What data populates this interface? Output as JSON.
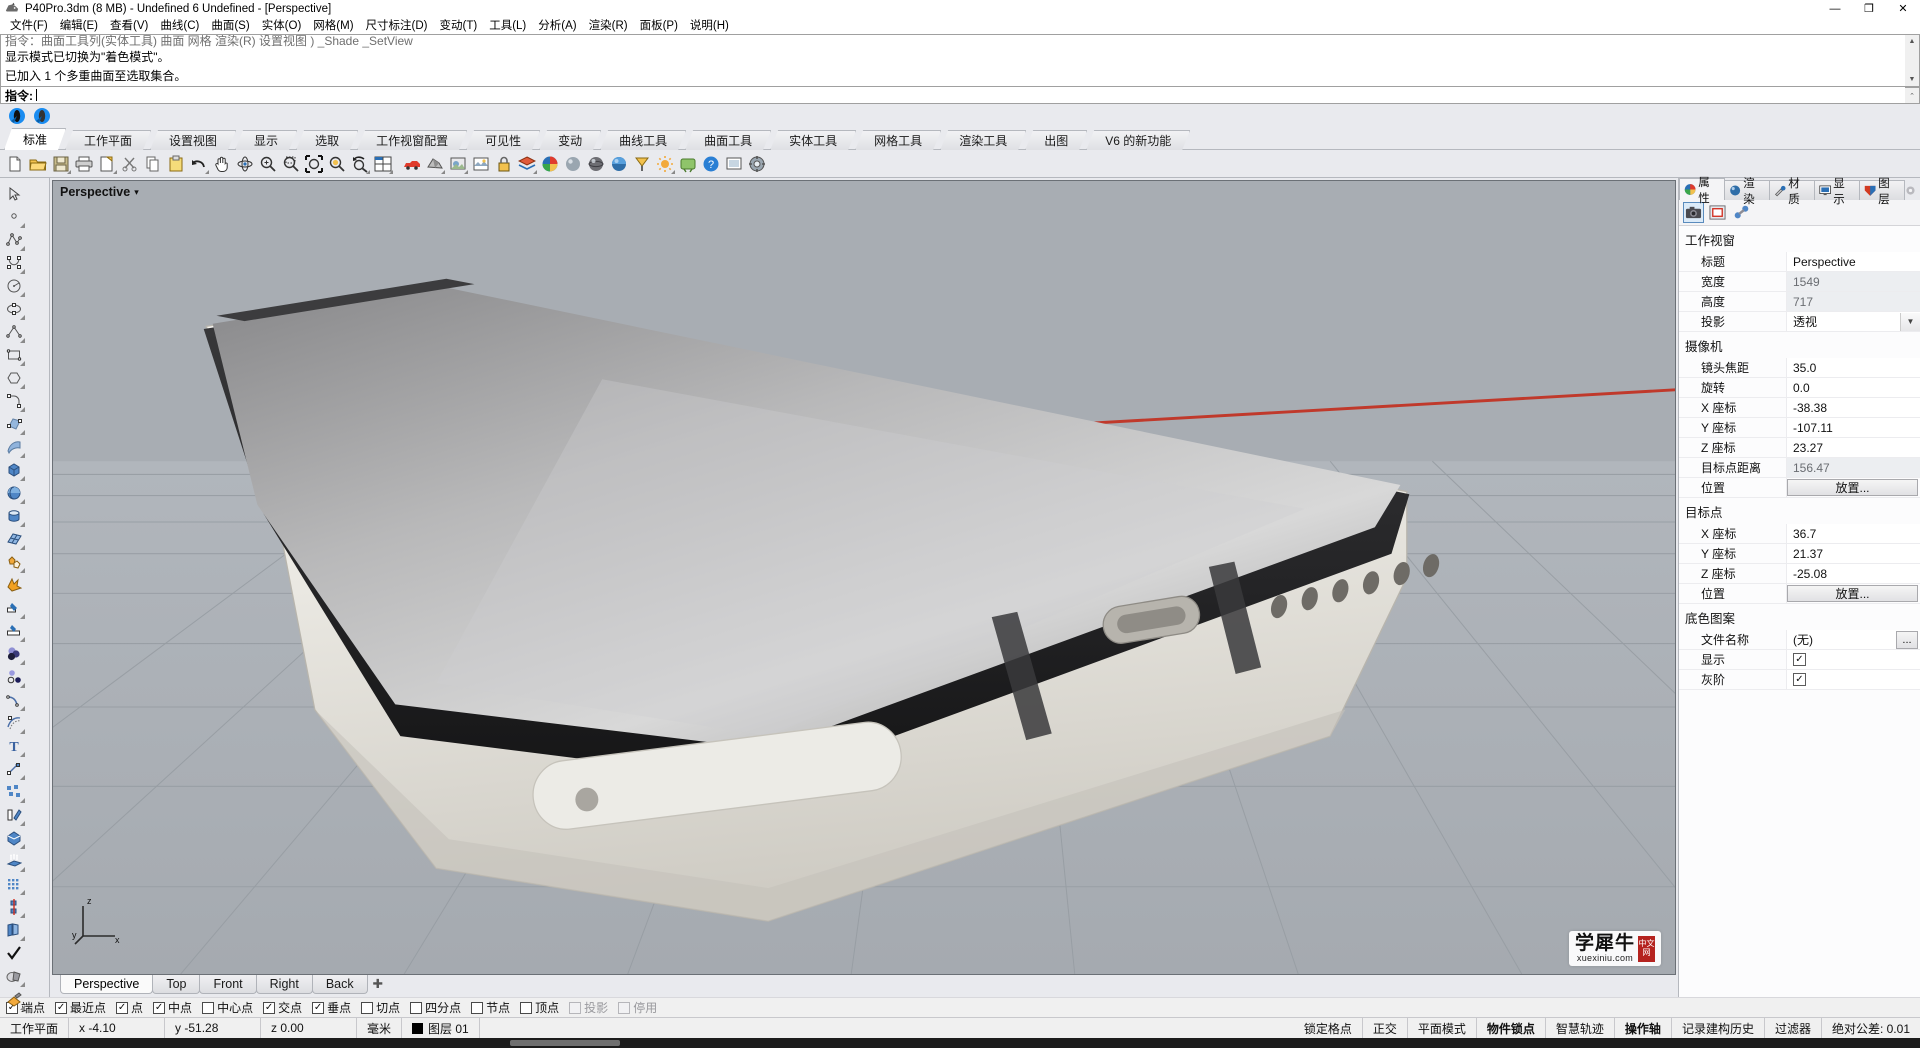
{
  "window": {
    "title": "P40Pro.3dm (8 MB) - Undefined 6 Undefined - [Perspective]",
    "minimize": "—",
    "maximize": "❐",
    "close": "✕"
  },
  "menu": {
    "items": [
      "文件(F)",
      "编辑(E)",
      "查看(V)",
      "曲线(C)",
      "曲面(S)",
      "实体(O)",
      "网格(M)",
      "尺寸标注(D)",
      "变动(T)",
      "工具(L)",
      "分析(A)",
      "渲染(R)",
      "面板(P)",
      "说明(H)"
    ]
  },
  "command_history": {
    "clipped_line": "指令：曲面工具列(实体工具)  曲面 网格  渲染(R)  设置视图 ) _Shade  _SetView",
    "lines": [
      "显示模式已切换为\"着色模式\"。",
      "已加入 1 个多重曲面至选取集合。"
    ],
    "prompt_label": "指令:",
    "prompt_value": ""
  },
  "ribbon": {
    "tabs": [
      {
        "label": "标准",
        "active": true
      },
      {
        "label": "工作平面",
        "active": false
      },
      {
        "label": "设置视图",
        "active": false
      },
      {
        "label": "显示",
        "active": false
      },
      {
        "label": "选取",
        "active": false
      },
      {
        "label": "工作视窗配置",
        "active": false
      },
      {
        "label": "可见性",
        "active": false
      },
      {
        "label": "变动",
        "active": false
      },
      {
        "label": "曲线工具",
        "active": false
      },
      {
        "label": "曲面工具",
        "active": false
      },
      {
        "label": "实体工具",
        "active": false
      },
      {
        "label": "网格工具",
        "active": false
      },
      {
        "label": "渲染工具",
        "active": false
      },
      {
        "label": "出图",
        "active": false
      },
      {
        "label": "V6 的新功能",
        "active": false
      }
    ]
  },
  "main_toolbar": {
    "buttons": [
      {
        "name": "new-file-icon",
        "glyph": "new"
      },
      {
        "name": "open-file-icon",
        "glyph": "open"
      },
      {
        "name": "save-file-icon",
        "glyph": "save"
      },
      {
        "name": "print-icon",
        "glyph": "print"
      },
      {
        "name": "cut-to-clipboard-icon",
        "glyph": "export"
      },
      {
        "name": "scissors-cut-icon",
        "glyph": "scissors"
      },
      {
        "name": "copy-icon",
        "glyph": "copy"
      },
      {
        "name": "paste-icon",
        "glyph": "paste"
      },
      {
        "name": "undo-icon",
        "glyph": "undo"
      },
      {
        "name": "pan-hand-icon",
        "glyph": "hand"
      },
      {
        "name": "rotate-view-icon",
        "glyph": "rotate"
      },
      {
        "name": "zoom-in-out-icon",
        "glyph": "zoomplus"
      },
      {
        "name": "zoom-window-icon",
        "glyph": "zoomwin"
      },
      {
        "name": "zoom-extents-icon",
        "glyph": "zoomext"
      },
      {
        "name": "zoom-selected-icon",
        "glyph": "zoomsel"
      },
      {
        "name": "zoom-previous-icon",
        "glyph": "zoomprev"
      },
      {
        "name": "four-viewport-icon",
        "glyph": "fourview"
      },
      {
        "name": "render-car-icon",
        "glyph": "car"
      },
      {
        "name": "shade-icon",
        "glyph": "shade"
      },
      {
        "name": "render-preview-icon",
        "glyph": "renderprev"
      },
      {
        "name": "named-view-icon",
        "glyph": "namedview"
      },
      {
        "name": "lock-layer-icon",
        "glyph": "lock"
      },
      {
        "name": "layer-icon",
        "glyph": "layers"
      },
      {
        "name": "color-wheel-icon",
        "glyph": "colorwheel"
      },
      {
        "name": "sphere-render-icon",
        "glyph": "sphere"
      },
      {
        "name": "material-ball-icon",
        "glyph": "matball"
      },
      {
        "name": "environment-icon",
        "glyph": "envball"
      },
      {
        "name": "light-icon",
        "glyph": "light"
      },
      {
        "name": "sun-icon",
        "glyph": "sun"
      },
      {
        "name": "grasshopper-icon",
        "glyph": "gh"
      },
      {
        "name": "help-icon",
        "glyph": "help"
      },
      {
        "name": "display-mode-icon",
        "glyph": "displaymode"
      },
      {
        "name": "options-icon",
        "glyph": "options"
      }
    ]
  },
  "left_toolbar": {
    "buttons": [
      {
        "name": "select-arrow-icon"
      },
      {
        "name": "point-object-icon"
      },
      {
        "name": "polyline-icon"
      },
      {
        "name": "control-point-curve-icon"
      },
      {
        "name": "circle-icon"
      },
      {
        "name": "ellipse-icon"
      },
      {
        "name": "arc-icon"
      },
      {
        "name": "rectangle-icon"
      },
      {
        "name": "polygon-icon"
      },
      {
        "name": "curve-fillet-icon"
      },
      {
        "name": "surface-from-points-icon"
      },
      {
        "name": "surface-sweep-icon"
      },
      {
        "name": "box-solid-icon"
      },
      {
        "name": "sphere-solid-icon"
      },
      {
        "name": "cylinder-icon"
      },
      {
        "name": "mesh-icon"
      },
      {
        "name": "boolean-union-icon"
      },
      {
        "name": "explode-icon"
      },
      {
        "name": "trim-icon"
      },
      {
        "name": "split-icon"
      },
      {
        "name": "boolean-ops-icon"
      },
      {
        "name": "boolean-difference-icon"
      },
      {
        "name": "fillet-curve-icon"
      },
      {
        "name": "offset-curve-icon"
      },
      {
        "name": "text-icon"
      },
      {
        "name": "dimension-icon"
      },
      {
        "name": "array-icon"
      },
      {
        "name": "extrude-icon"
      },
      {
        "name": "cap-solid-icon"
      },
      {
        "name": "extrude-surface-icon"
      },
      {
        "name": "rectangular-array-icon"
      },
      {
        "name": "mirror-icon"
      },
      {
        "name": "unroll-icon"
      },
      {
        "name": "check-object-icon"
      },
      {
        "name": "shade-object-icon"
      },
      {
        "name": "render-color-icon"
      }
    ]
  },
  "viewport": {
    "title": "Perspective",
    "dropdown_glyph": "▾",
    "axis": {
      "x": "x",
      "y": "y",
      "z": "z"
    },
    "tabs": [
      {
        "label": "Perspective",
        "active": true
      },
      {
        "label": "Top",
        "active": false
      },
      {
        "label": "Front",
        "active": false
      },
      {
        "label": "Right",
        "active": false
      },
      {
        "label": "Back",
        "active": false
      }
    ],
    "add_tab_glyph": "✚"
  },
  "right_panel": {
    "tabs": [
      {
        "label": "属性",
        "icon": "properties-color-wheel-icon",
        "active": true
      },
      {
        "label": "渲染",
        "icon": "render-sphere-icon",
        "active": false
      },
      {
        "label": "材质",
        "icon": "material-brush-icon",
        "active": false
      },
      {
        "label": "显示",
        "icon": "display-monitor-icon",
        "active": false
      },
      {
        "label": "图层",
        "icon": "layers-shield-icon",
        "active": false
      }
    ],
    "sub_tools": [
      {
        "name": "camera-tool-icon",
        "active": true
      },
      {
        "name": "viewport-frame-tool-icon",
        "active": false
      },
      {
        "name": "chain-link-tool-icon",
        "active": false
      }
    ],
    "sections": [
      {
        "title": "工作视窗",
        "rows": [
          {
            "label": "标题",
            "value": "Perspective",
            "type": "text",
            "readonly": false
          },
          {
            "label": "宽度",
            "value": "1549",
            "type": "text",
            "readonly": true
          },
          {
            "label": "高度",
            "value": "717",
            "type": "text",
            "readonly": true
          },
          {
            "label": "投影",
            "value": "透视",
            "type": "combo",
            "readonly": false
          }
        ]
      },
      {
        "title": "摄像机",
        "rows": [
          {
            "label": "镜头焦距",
            "value": "35.0",
            "type": "text",
            "readonly": false
          },
          {
            "label": "旋转",
            "value": "0.0",
            "type": "text",
            "readonly": false
          },
          {
            "label": "X 座标",
            "value": "-38.38",
            "type": "text",
            "readonly": false
          },
          {
            "label": "Y 座标",
            "value": "-107.11",
            "type": "text",
            "readonly": false
          },
          {
            "label": "Z 座标",
            "value": "23.27",
            "type": "text",
            "readonly": false
          },
          {
            "label": "目标点距离",
            "value": "156.47",
            "type": "text",
            "readonly": true
          },
          {
            "label": "位置",
            "value": "放置...",
            "type": "button",
            "readonly": false
          }
        ]
      },
      {
        "title": "目标点",
        "rows": [
          {
            "label": "X 座标",
            "value": "36.7",
            "type": "text",
            "readonly": false
          },
          {
            "label": "Y 座标",
            "value": "21.37",
            "type": "text",
            "readonly": false
          },
          {
            "label": "Z 座标",
            "value": "-25.08",
            "type": "text",
            "readonly": false
          },
          {
            "label": "位置",
            "value": "放置...",
            "type": "button",
            "readonly": false
          }
        ]
      },
      {
        "title": "底色图案",
        "rows": [
          {
            "label": "文件名称",
            "value": "(无)",
            "type": "file",
            "readonly": false
          },
          {
            "label": "显示",
            "value": "",
            "type": "checkbox",
            "checked": true,
            "readonly": false
          },
          {
            "label": "灰阶",
            "value": "",
            "type": "checkbox",
            "checked": true,
            "readonly": false
          }
        ]
      }
    ],
    "ellipsis_label": "..."
  },
  "watermark": {
    "cn": "学犀牛",
    "en": "xuexiniu.com",
    "badge_line1": "中文",
    "badge_line2": "网"
  },
  "osnap_bar": {
    "items": [
      {
        "label": "端点",
        "checked": true,
        "dim": false
      },
      {
        "label": "最近点",
        "checked": true,
        "dim": false
      },
      {
        "label": "点",
        "checked": true,
        "dim": false
      },
      {
        "label": "中点",
        "checked": true,
        "dim": false
      },
      {
        "label": "中心点",
        "checked": false,
        "dim": false
      },
      {
        "label": "交点",
        "checked": true,
        "dim": false
      },
      {
        "label": "垂点",
        "checked": true,
        "dim": false
      },
      {
        "label": "切点",
        "checked": false,
        "dim": false
      },
      {
        "label": "四分点",
        "checked": false,
        "dim": false
      },
      {
        "label": "节点",
        "checked": false,
        "dim": false
      },
      {
        "label": "顶点",
        "checked": false,
        "dim": false
      },
      {
        "label": "投影",
        "checked": false,
        "dim": true
      },
      {
        "label": "停用",
        "checked": false,
        "dim": true
      }
    ]
  },
  "status_bar": {
    "cplane": "工作平面",
    "x": "x -4.10",
    "y": "y -51.28",
    "z": "z 0.00",
    "units": "毫米",
    "layer": "图层 01",
    "toggles": [
      {
        "label": "锁定格点",
        "bold": false
      },
      {
        "label": "正交",
        "bold": false
      },
      {
        "label": "平面模式",
        "bold": false
      },
      {
        "label": "物件锁点",
        "bold": true
      },
      {
        "label": "智慧轨迹",
        "bold": false
      },
      {
        "label": "操作轴",
        "bold": true
      },
      {
        "label": "记录建构历史",
        "bold": false
      },
      {
        "label": "过滤器",
        "bold": false
      }
    ],
    "tolerance": "绝对公差: 0.01"
  }
}
